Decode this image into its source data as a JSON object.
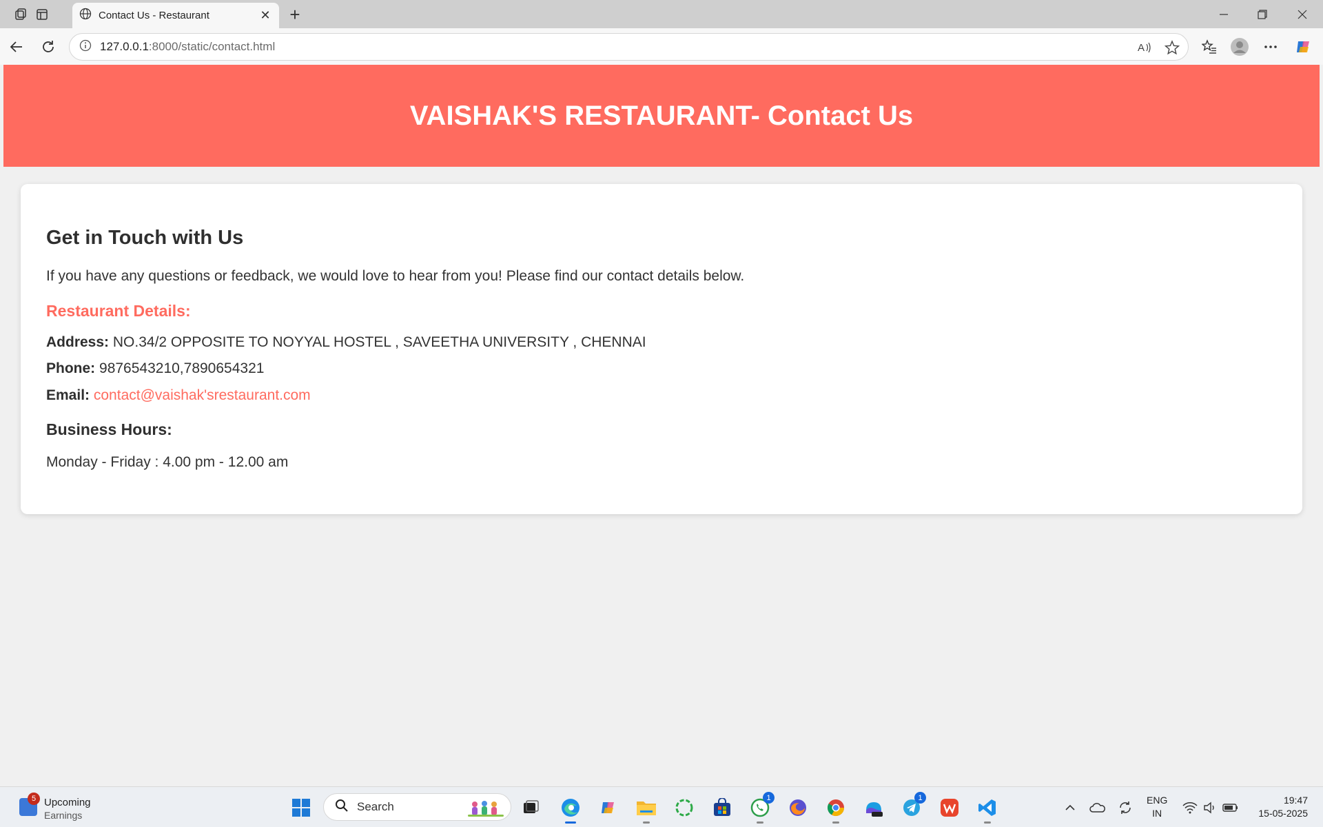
{
  "browser": {
    "tab_title": "Contact Us - Restaurant",
    "url_host": "127.0.0.1",
    "url_rest": ":8000/static/contact.html"
  },
  "page": {
    "header_title": "VAISHAK'S RESTAURANT- Contact Us",
    "heading": "Get in Touch with Us",
    "intro": "If you have any questions or feedback, we would love to hear from you! Please find our contact details below.",
    "details_title": "Restaurant Details:",
    "address_label": "Address:",
    "address_value": "NO.34/2 OPPOSITE TO NOYYAL HOSTEL , SAVEETHA UNIVERSITY , CHENNAI",
    "phone_label": "Phone:",
    "phone_value": "9876543210,7890654321",
    "email_label": "Email:",
    "email_value": "contact@vaishak'srestaurant.com",
    "hours_title": "Business Hours:",
    "hours_value": "Monday - Friday : 4.00 pm - 12.00 am",
    "accent_color": "#ff6b5f"
  },
  "taskbar": {
    "widget_badge": "5",
    "widget_line1": "Upcoming",
    "widget_line2": "Earnings",
    "search_label": "Search",
    "whatsapp_badge": "1",
    "telegram_badge": "1",
    "lang_line1": "ENG",
    "lang_line2": "IN",
    "time": "19:47",
    "date": "15-05-2025"
  }
}
